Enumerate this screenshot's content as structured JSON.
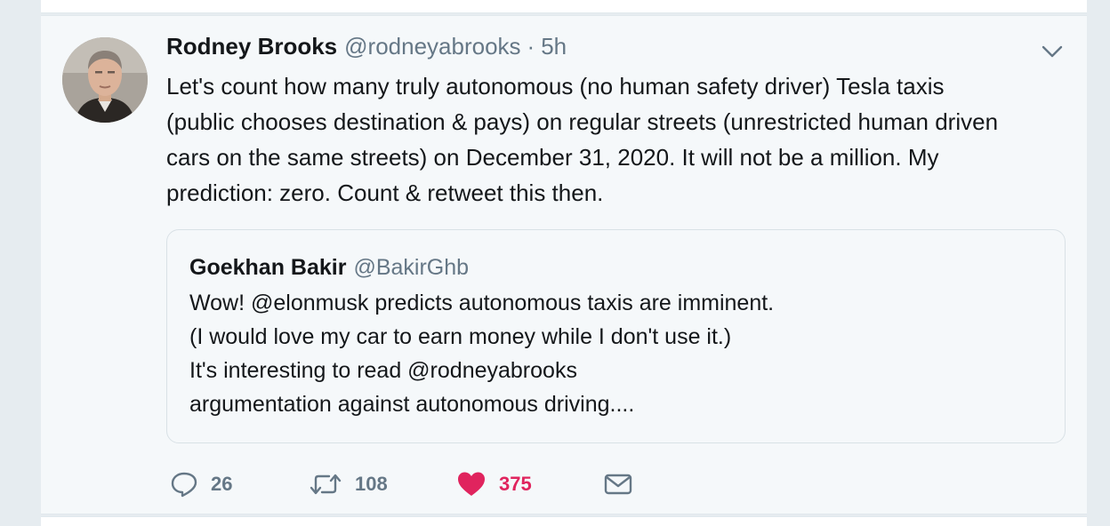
{
  "tweet": {
    "author_name": "Rodney Brooks",
    "author_handle": "@rodneyabrooks",
    "separator": "·",
    "time": "5h",
    "text": "Let's count how many truly autonomous (no human safety driver) Tesla taxis\n(public chooses destination & pays) on regular streets (unrestricted human driven\ncars on the same streets) on December 31, 2020. It will not be a million. My\nprediction: zero. Count & retweet this then.",
    "menu_icon": "chevron-down-icon"
  },
  "quoted_tweet": {
    "author_name": "Goekhan Bakir",
    "author_handle": "@BakirGhb",
    "text": "Wow! @elonmusk predicts autonomous taxis are imminent.\n(I would love my car to earn money while I don't use it.)\nIt's interesting to read @rodneyabrooks\nargumentation against autonomous driving...."
  },
  "actions": {
    "reply": {
      "icon": "reply-icon",
      "count": "26"
    },
    "retweet": {
      "icon": "retweet-icon",
      "count": "108"
    },
    "like": {
      "icon": "heart-icon",
      "count": "375",
      "liked": true
    },
    "direct_message": {
      "icon": "envelope-icon"
    }
  },
  "colors": {
    "primary_text": "#14171a",
    "secondary_text": "#657786",
    "like_active": "#e0245e",
    "card_background": "#f5f8fa",
    "page_background": "#e6ecf0",
    "border": "#e1e8ed"
  }
}
